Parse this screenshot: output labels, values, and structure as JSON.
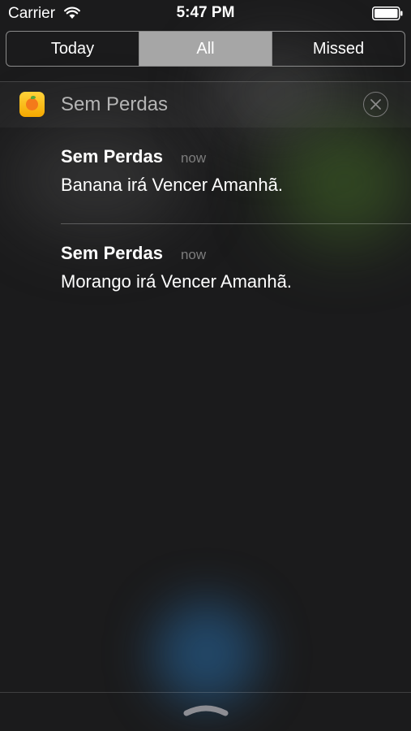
{
  "status_bar": {
    "carrier": "Carrier",
    "time": "5:47 PM"
  },
  "tabs": [
    {
      "label": "Today",
      "selected": false
    },
    {
      "label": "All",
      "selected": true
    },
    {
      "label": "Missed",
      "selected": false
    }
  ],
  "section": {
    "app_name": "Sem Perdas",
    "app_icon": "orange-fruit-icon"
  },
  "notifications": [
    {
      "title": "Sem Perdas",
      "time": "now",
      "message": "Banana irá Vencer Amanhã."
    },
    {
      "title": "Sem Perdas",
      "time": "now",
      "message": "Morango irá Vencer Amanhã."
    }
  ],
  "colors": {
    "selected_tab": "#a6a6a6",
    "app_icon": "#ffc21a"
  }
}
